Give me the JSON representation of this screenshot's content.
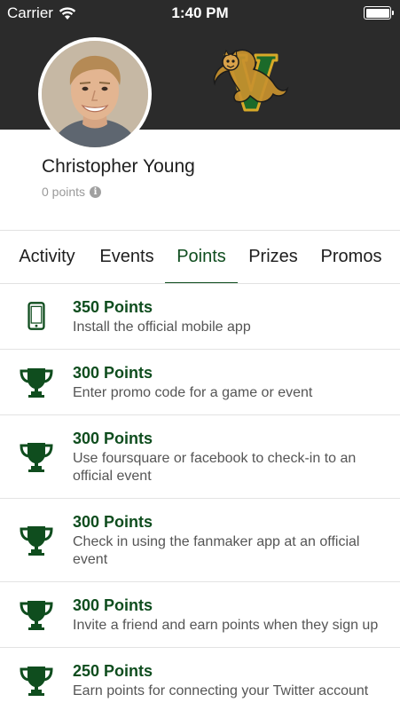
{
  "status_bar": {
    "carrier": "Carrier",
    "time": "1:40 PM"
  },
  "profile": {
    "name": "Christopher Young",
    "points": "0 points"
  },
  "tabs": [
    {
      "label": "Activity",
      "active": false
    },
    {
      "label": "Events",
      "active": false
    },
    {
      "label": "Points",
      "active": true
    },
    {
      "label": "Prizes",
      "active": false
    },
    {
      "label": "Promos",
      "active": false
    }
  ],
  "points_list": [
    {
      "icon": "phone-icon",
      "title": "350 Points",
      "description": "Install the official mobile app"
    },
    {
      "icon": "trophy-icon",
      "title": "300 Points",
      "description": "Enter promo code for a game or event"
    },
    {
      "icon": "trophy-icon",
      "title": "300 Points",
      "description": "Use foursquare or facebook to check-in to an official event"
    },
    {
      "icon": "trophy-icon",
      "title": "300 Points",
      "description": "Check in using the fanmaker app at an official event"
    },
    {
      "icon": "trophy-icon",
      "title": "300 Points",
      "description": "Invite a friend and earn points when they sign up"
    },
    {
      "icon": "trophy-icon",
      "title": "250 Points",
      "description": "Earn points for connecting your Twitter account"
    }
  ],
  "colors": {
    "accent": "#0f4d1e",
    "header_bg": "#2b2b2b",
    "logo_green": "#1b6a2a",
    "logo_gold": "#d7a928"
  }
}
